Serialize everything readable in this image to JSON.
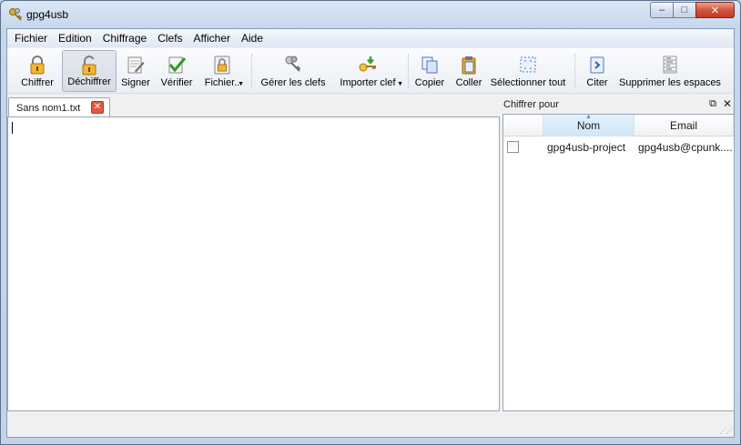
{
  "window": {
    "title": "gpg4usb",
    "buttons": {
      "minimize": "–",
      "maximize": "□",
      "close": "✕"
    }
  },
  "menu": [
    "Fichier",
    "Edition",
    "Chiffrage",
    "Clefs",
    "Afficher",
    "Aide"
  ],
  "toolbar": {
    "encrypt": "Chiffrer",
    "decrypt": "Déchiffrer",
    "sign": "Signer",
    "verify": "Vérifier",
    "file": "Fichier..",
    "manage_keys": "Gérer les clefs",
    "import_key": "Importer clef",
    "copy": "Copier",
    "paste": "Coller",
    "select_all": "Sélectionner tout",
    "quote": "Citer",
    "remove_spaces": "Supprimer les espaces"
  },
  "editor": {
    "tab_label": "Sans nom1.txt",
    "content": ""
  },
  "dock": {
    "title": "Chiffrer pour",
    "columns": [
      "Nom",
      "Email"
    ],
    "rows": [
      {
        "checked": false,
        "name": "gpg4usb-project",
        "email": "gpg4usb@cpunk...."
      }
    ]
  },
  "colors": {
    "accent": "#c6d7ec",
    "close_button": "#d1553d",
    "sorted_header": "#cfe6f7"
  }
}
